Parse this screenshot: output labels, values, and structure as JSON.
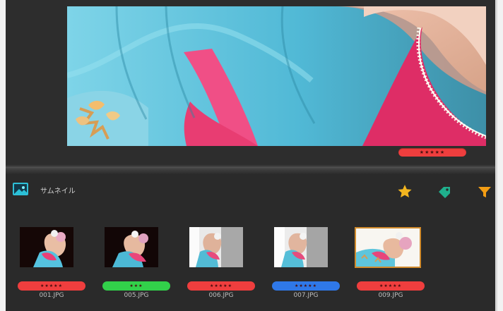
{
  "viewer": {
    "rating": "★★★★★",
    "rating_color": "#ef3e3e"
  },
  "thumbnails": {
    "title": "サムネイル",
    "icons": [
      "star-icon",
      "tag-icon",
      "filter-icon"
    ],
    "items": [
      {
        "filename": "001.JPG",
        "rating": "★★★★★",
        "color": "#ef3e3e",
        "selected": false
      },
      {
        "filename": "005.JPG",
        "rating": "★★★",
        "color": "#32d14a",
        "selected": false
      },
      {
        "filename": "006.JPG",
        "rating": "★★★★★",
        "color": "#ef3e3e",
        "selected": false
      },
      {
        "filename": "007.JPG",
        "rating": "★★★★★",
        "color": "#2f78e8",
        "selected": false
      },
      {
        "filename": "009.JPG",
        "rating": "★★★★★",
        "color": "#ef3e3e",
        "selected": true
      }
    ]
  }
}
